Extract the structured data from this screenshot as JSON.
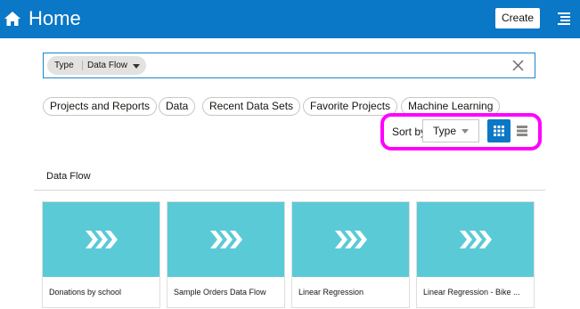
{
  "header": {
    "title": "Home",
    "create_label": "Create",
    "icons": {
      "home": "home-icon",
      "menu": "hamburger-menu-icon"
    },
    "bar_color": "#0a77c7"
  },
  "search": {
    "filter_key": "Type",
    "filter_value": "Data Flow",
    "border_color": "#1b86cc"
  },
  "filters": [
    "Projects and Reports",
    "Data",
    "Recent Data Sets",
    "Favorite Projects",
    "Machine Learning"
  ],
  "sort": {
    "label": "Sort by",
    "value": "Type",
    "views": [
      "grid-view",
      "list-view"
    ],
    "active_view": "grid-view",
    "highlight_color": "#ff00ff"
  },
  "section": {
    "title": "Data Flow"
  },
  "cards": [
    {
      "label": "Donations by school"
    },
    {
      "label": "Sample Orders Data Flow"
    },
    {
      "label": "Linear Regression"
    },
    {
      "label": "Linear Regression - Bike ..."
    }
  ],
  "card_color": "#5bcad7"
}
